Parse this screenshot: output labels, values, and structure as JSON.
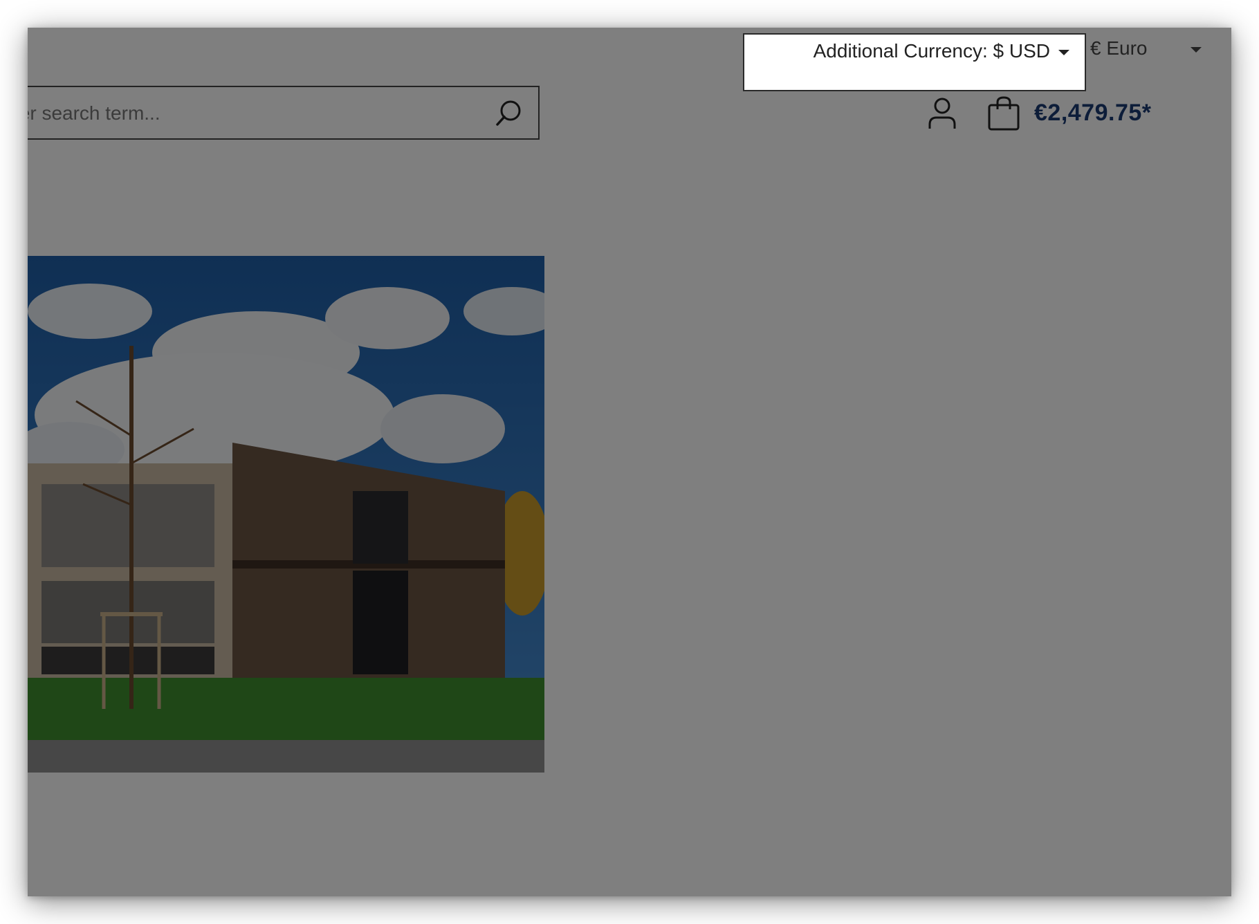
{
  "header": {
    "search": {
      "placeholder": "Enter search term...",
      "visible_text": "ter search term..."
    },
    "account_icon": "user-icon",
    "cart_icon": "shopping-bag-icon",
    "cart_total": "€2,479.75*"
  },
  "top_bar": {
    "additional_currency_label": "Additional Currency: $ USD",
    "currency_label": "€ Euro"
  },
  "hero": {
    "image_subject": "Modern two-story wooden office building under a blue sky with clouds, lawn and young tree in front"
  },
  "colors": {
    "overlay": "#000000",
    "price": "#1b3a73",
    "sky": "#2f78c2"
  }
}
